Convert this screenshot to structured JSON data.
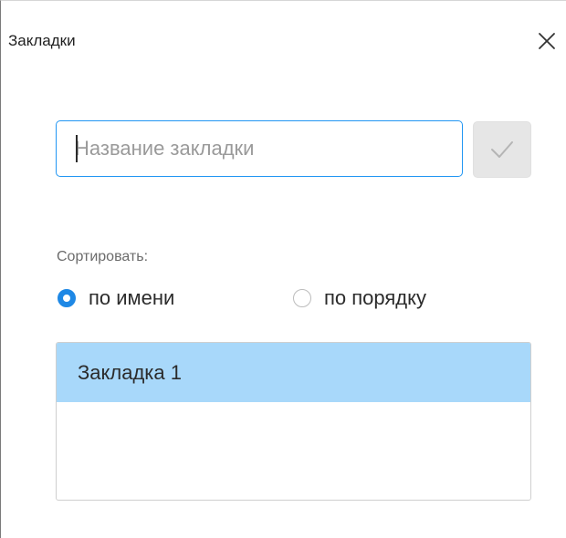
{
  "dialog": {
    "title": "Закладки"
  },
  "name_input": {
    "placeholder": "Название закладки",
    "value": ""
  },
  "sort": {
    "label": "Сортировать:",
    "options": [
      {
        "label": "по имени",
        "selected": true
      },
      {
        "label": "по порядку",
        "selected": false
      }
    ]
  },
  "bookmarks": {
    "items": [
      {
        "label": "Закладка 1",
        "selected": true
      }
    ]
  },
  "colors": {
    "accent": "#1e88e5",
    "focus_border": "#2196f3",
    "selection": "#a8d8fa",
    "disabled_button": "#e6e6e6"
  },
  "icons": {
    "close": "close-icon",
    "confirm": "checkmark-icon"
  }
}
